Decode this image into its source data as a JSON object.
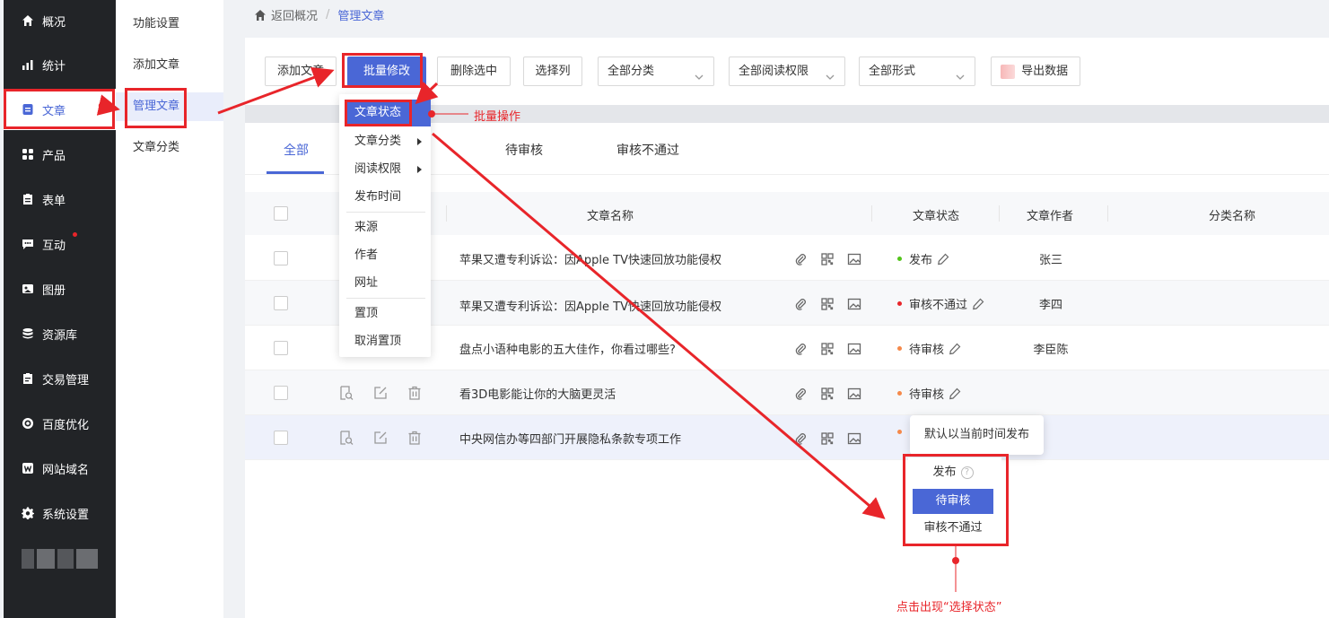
{
  "sidebar": {
    "items": [
      {
        "label": "概况",
        "icon": "home-icon"
      },
      {
        "label": "统计",
        "icon": "chart-icon"
      },
      {
        "label": "文章",
        "icon": "document-icon"
      },
      {
        "label": "产品",
        "icon": "grid-icon"
      },
      {
        "label": "表单",
        "icon": "form-icon"
      },
      {
        "label": "互动",
        "icon": "chat-icon"
      },
      {
        "label": "图册",
        "icon": "image-icon"
      },
      {
        "label": "资源库",
        "icon": "database-icon"
      },
      {
        "label": "交易管理",
        "icon": "clipboard-icon"
      },
      {
        "label": "百度优化",
        "icon": "target-icon"
      },
      {
        "label": "网站域名",
        "icon": "w-icon"
      },
      {
        "label": "系统设置",
        "icon": "gear-icon"
      }
    ]
  },
  "subnav": {
    "items": [
      {
        "label": "功能设置"
      },
      {
        "label": "添加文章"
      },
      {
        "label": "管理文章"
      },
      {
        "label": "文章分类"
      }
    ]
  },
  "breadcrumb": {
    "back": "返回概况",
    "sep": "/",
    "current": "管理文章"
  },
  "toolbar": {
    "add": "添加文章",
    "batch_edit": "批量修改",
    "delete_selected": "删除选中",
    "select_columns": "选择列",
    "category_filter": "全部分类",
    "permission_filter": "全部阅读权限",
    "form_filter": "全部形式",
    "export": "导出数据"
  },
  "tabs": [
    "全部",
    "待审核",
    "审核不通过"
  ],
  "table": {
    "headers": {
      "title": "文章名称",
      "status": "文章状态",
      "author": "文章作者",
      "category": "分类名称"
    },
    "rows": [
      {
        "title": "苹果又遭专利诉讼：因Apple TV快速回放功能侵权",
        "status": "发布",
        "author": "张三"
      },
      {
        "title": "苹果又遭专利诉讼：因Apple TV快速回放功能侵权",
        "status": "审核不通过",
        "author": "李四"
      },
      {
        "title": "盘点小语种电影的五大佳作，你看过哪些?",
        "status": "待审核",
        "author": "李臣陈"
      },
      {
        "title": "看3D电影能让你的大脑更灵活",
        "status": "待审核",
        "author": ""
      },
      {
        "title": "中央网信办等四部门开展隐私条款专项工作",
        "status": "",
        "author": ""
      }
    ]
  },
  "batch_menu": {
    "items": [
      "文章状态",
      "文章分类",
      "阅读权限",
      "发布时间",
      "来源",
      "作者",
      "网址",
      "置顶",
      "取消置顶"
    ]
  },
  "tooltip": "默认以当前时间发布",
  "status_menu": {
    "items": [
      "发布",
      "待审核",
      "审核不通过"
    ],
    "help": "?"
  },
  "annotations": {
    "batch_op": "批量操作",
    "click_hint": "点击出现“选择状态”"
  },
  "colors": {
    "accent": "#4a67d6",
    "annotation_red": "#e8252a",
    "status_published": "#52c41a",
    "status_rejected": "#e8252a",
    "status_pending": "#f5894a"
  }
}
